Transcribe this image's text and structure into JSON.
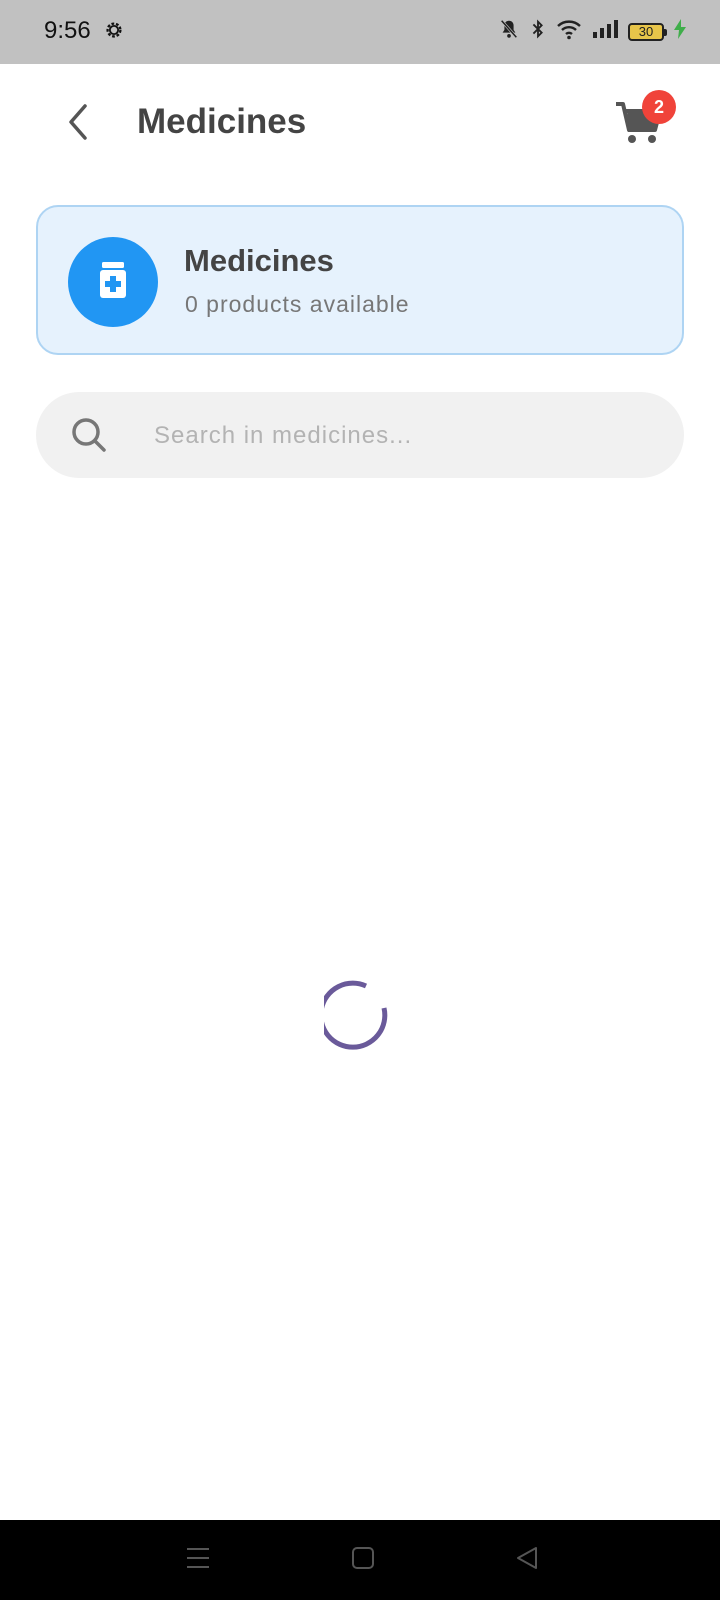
{
  "status_bar": {
    "time": "9:56",
    "battery_level": "30",
    "icons": [
      "settings-gear-icon",
      "notifications-muted-icon",
      "bluetooth-icon",
      "wifi-icon",
      "cellular-signal-icon",
      "battery-icon",
      "charging-bolt-icon"
    ]
  },
  "app_bar": {
    "title": "Medicines",
    "back_icon": "chevron-left-icon",
    "cart_icon": "shopping-cart-icon",
    "cart_count": "2"
  },
  "category": {
    "title": "Medicines",
    "subtitle": "0 products available",
    "icon": "medicine-bottle-icon"
  },
  "search": {
    "placeholder": "Search in medicines...",
    "value": ""
  },
  "loading": {
    "indicator": "spinner",
    "color": "#6a5a9a"
  },
  "nav_bar": {
    "items": [
      "menu-icon",
      "home-square-icon",
      "back-triangle-icon"
    ]
  },
  "colors": {
    "accent": "#2196f3",
    "badge": "#f0433a",
    "card_bg": "#e6f2fd",
    "card_border": "#aed4f3"
  }
}
